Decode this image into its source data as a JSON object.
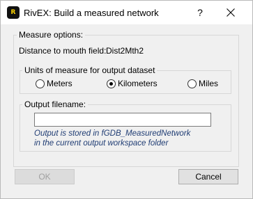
{
  "window": {
    "icon_text": "R",
    "title": "RivEX: Build a measured network",
    "help_label": "?",
    "close_icon": "close-icon"
  },
  "measure_options": {
    "heading": "Measure options:",
    "distance_label": "Distance to mouth field:",
    "distance_value": "Dist2Mth2"
  },
  "units_group": {
    "legend": "Units of measure for output dataset",
    "options": [
      {
        "label": "Meters",
        "selected": false
      },
      {
        "label": "Kilometers",
        "selected": true
      },
      {
        "label": "Miles",
        "selected": false
      }
    ]
  },
  "output_group": {
    "legend": "Output filename:",
    "value": "",
    "hint_line1": "Output is stored in fGDB_MeasuredNetwork",
    "hint_line2": "in the current output workspace folder"
  },
  "buttons": {
    "ok": "OK",
    "cancel": "Cancel"
  }
}
